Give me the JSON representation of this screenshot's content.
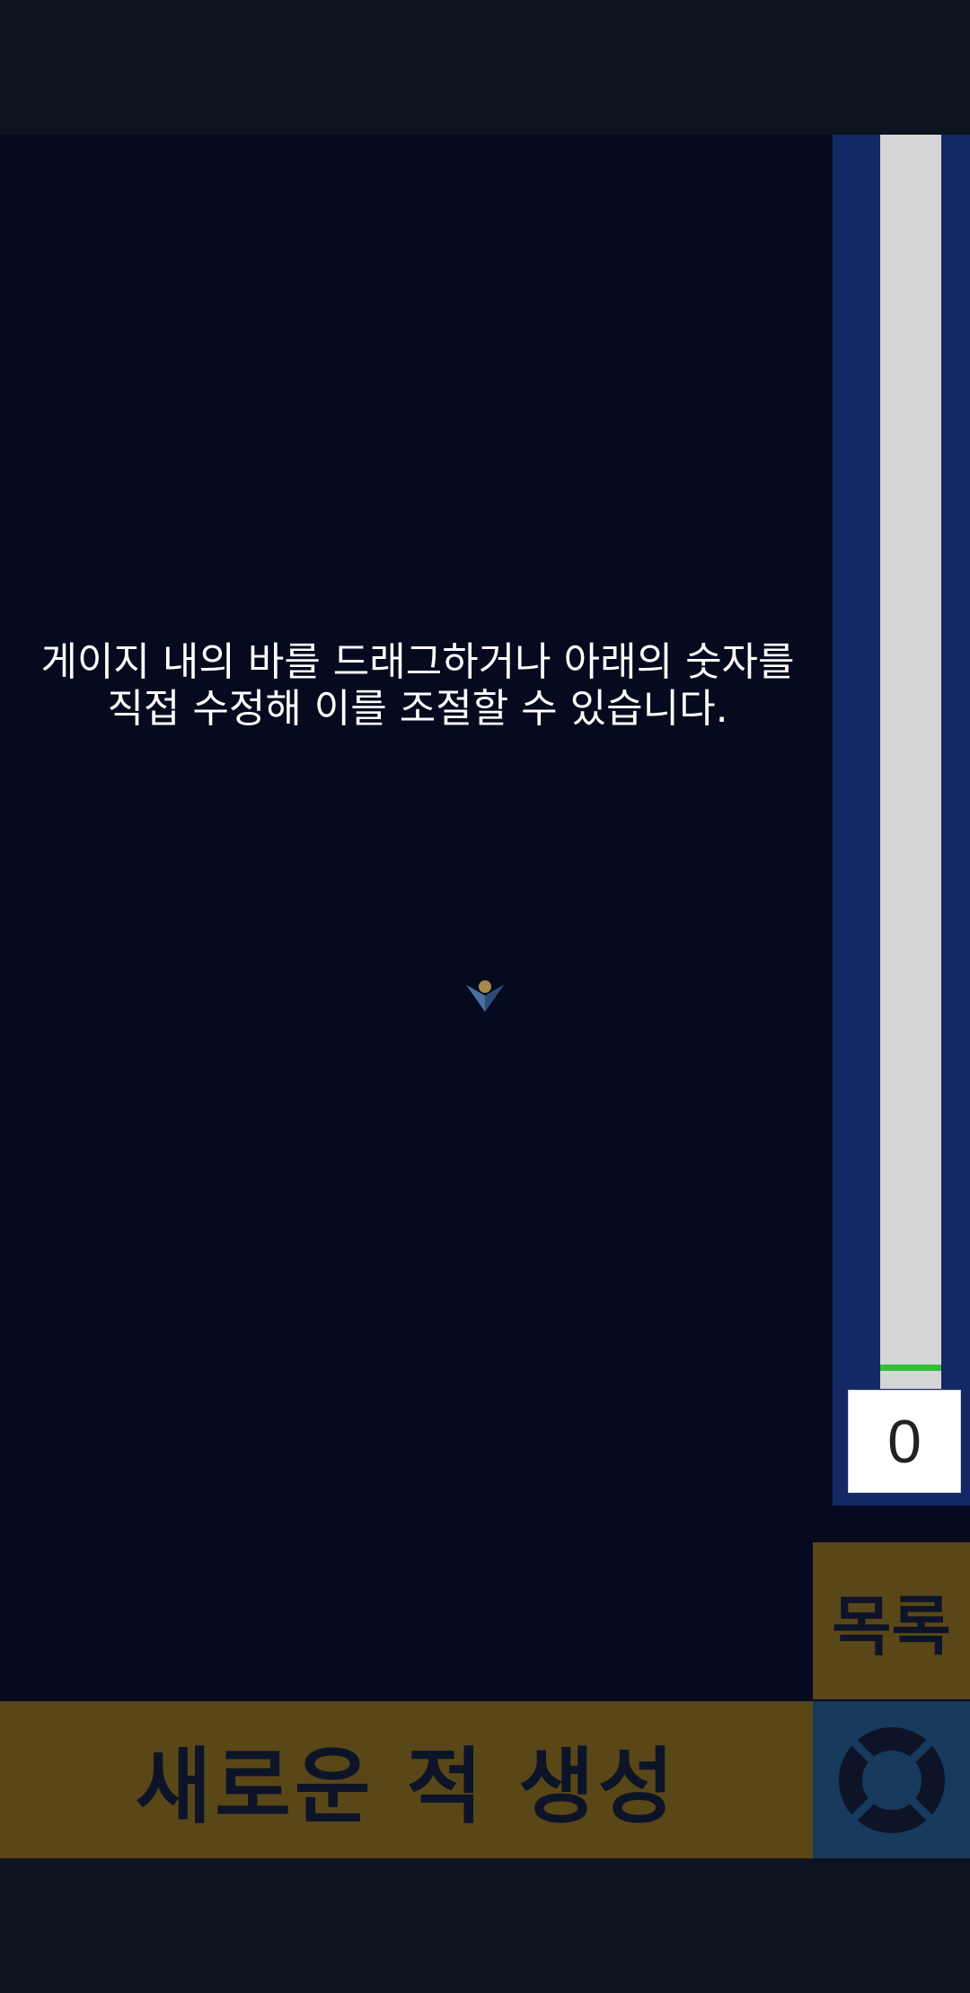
{
  "hint": {
    "text": "게이지 내의 바를 드래그하거나 아래의 숫자를\n직접 수정해 이를 조절할 수 있습니다."
  },
  "gauge": {
    "value": "0",
    "level_fraction": 0.0,
    "bar_color": "#2fbf3a"
  },
  "buttons": {
    "list_label": "목록",
    "spawn_label": "새로운 적 생성",
    "settings_icon": "lifebuoy-icon"
  },
  "colors": {
    "playfield": "#050a1e",
    "gauge_panel": "#132864",
    "button_gold": "#5a4718",
    "settings_blue": "#173a5c"
  }
}
